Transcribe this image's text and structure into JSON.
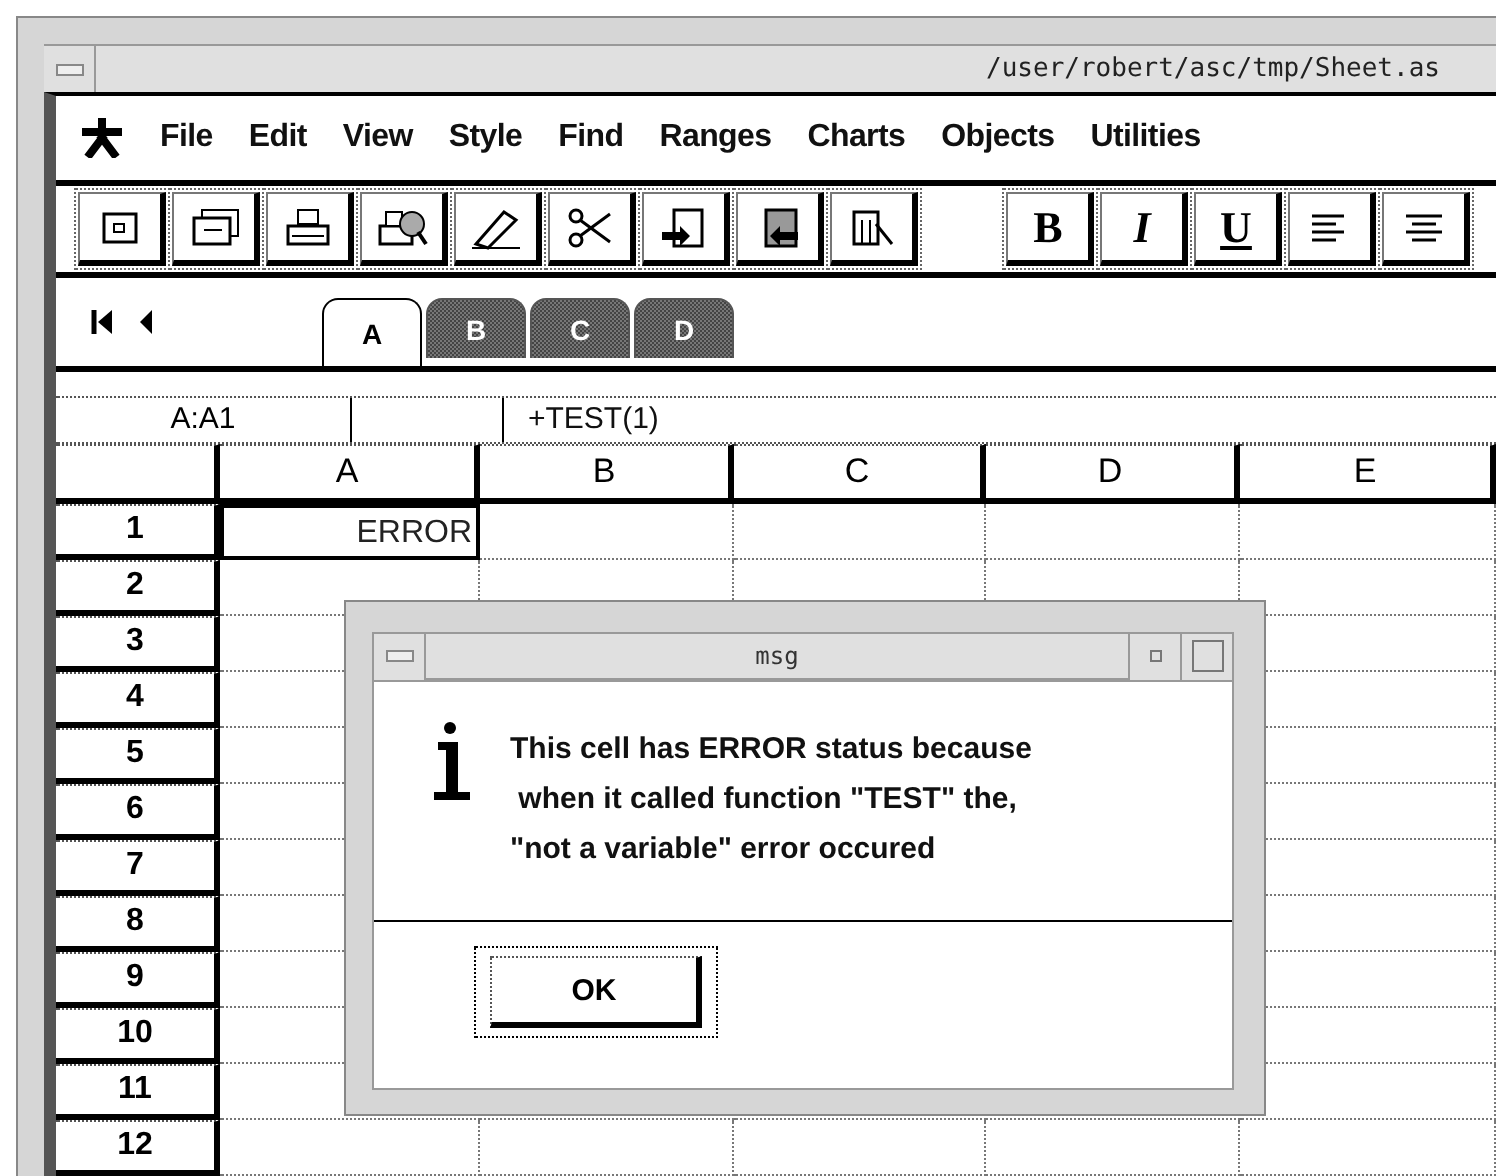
{
  "window": {
    "title": "/user/robert/asc/tmp/Sheet.as"
  },
  "menu": [
    {
      "label": "File"
    },
    {
      "label": "Edit"
    },
    {
      "label": "View"
    },
    {
      "label": "Style"
    },
    {
      "label": "Find"
    },
    {
      "label": "Ranges"
    },
    {
      "label": "Charts"
    },
    {
      "label": "Objects"
    },
    {
      "label": "Utilities"
    }
  ],
  "toolbar": {
    "format_buttons": [
      "B",
      "I",
      "U"
    ]
  },
  "sheet_tabs": [
    {
      "label": "A",
      "selected": true
    },
    {
      "label": "B",
      "selected": false
    },
    {
      "label": "C",
      "selected": false
    },
    {
      "label": "D",
      "selected": false
    }
  ],
  "formula_bar": {
    "cell_reference": "A:A1",
    "formula": "+TEST(1)"
  },
  "sheet": {
    "columns": [
      "A",
      "B",
      "C",
      "D",
      "E"
    ],
    "rows": [
      {
        "label": "1",
        "cells": [
          {
            "value": "ERROR",
            "selected": true
          }
        ]
      },
      {
        "label": "2"
      },
      {
        "label": "3"
      },
      {
        "label": "4"
      },
      {
        "label": "5"
      },
      {
        "label": "6"
      },
      {
        "label": "7"
      },
      {
        "label": "8"
      },
      {
        "label": "9"
      },
      {
        "label": "10"
      },
      {
        "label": "11"
      },
      {
        "label": "12"
      }
    ]
  },
  "dialog": {
    "title": "msg",
    "message_lines": [
      "This cell has ERROR status because",
      " when it called function \"TEST\" the,",
      "\"not a variable\" error occured"
    ],
    "button": "OK"
  }
}
